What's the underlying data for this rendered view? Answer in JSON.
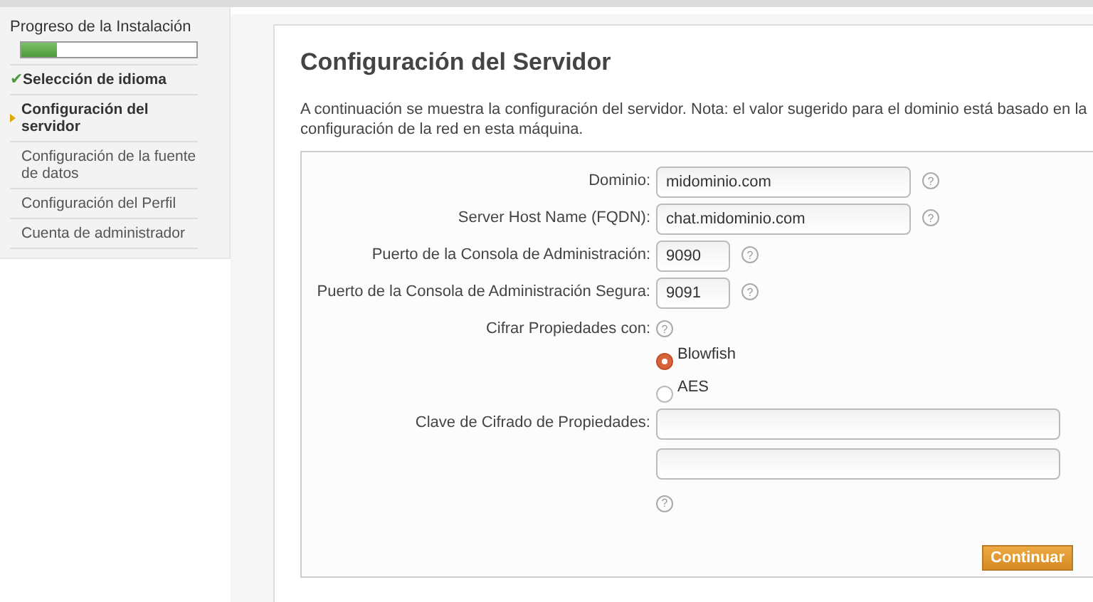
{
  "sidebar": {
    "title": "Progreso de la Instalación",
    "progress": {
      "level": 0.2
    },
    "steps": [
      {
        "label": "Selección de idioma",
        "kind": "done",
        "mark": "✔"
      },
      {
        "label": "Configuración del servidor",
        "kind": "current"
      },
      {
        "label": "Configuración de la fuente de datos",
        "kind": "pending"
      },
      {
        "label": "Configuración del Perfil",
        "kind": "pending"
      },
      {
        "label": "Cuenta de administrador",
        "kind": "pending"
      }
    ]
  },
  "main": {
    "title": "Configuración del Servidor",
    "description": "A continuación se muestra la configuración del servidor. Nota: el valor sugerido para el dominio está basado en la configuración de la red en esta máquina.",
    "fields": [
      {
        "kind": "text",
        "label": "Dominio:",
        "value": "midominio.com",
        "help": "?"
      },
      {
        "kind": "text",
        "label": "Server Host Name (FQDN):",
        "value": "chat.midominio.com",
        "help": "?"
      },
      {
        "kind": "port",
        "label": "Puerto de la Consola de Administración:",
        "value": "9090",
        "help": "?"
      },
      {
        "kind": "port",
        "label": "Puerto de la Consola de Administración Segura:",
        "value": "9091",
        "help": "?"
      },
      {
        "kind": "radio",
        "label": "Cifrar Propiedades con:",
        "help": "?",
        "options": [
          {
            "label": "Blowfish",
            "selected": true
          },
          {
            "label": "AES",
            "selected": false
          }
        ]
      },
      {
        "kind": "password",
        "label": "Clave de Cifrado de Propiedades:",
        "help": "?"
      }
    ],
    "continue_button": "Continuar"
  }
}
